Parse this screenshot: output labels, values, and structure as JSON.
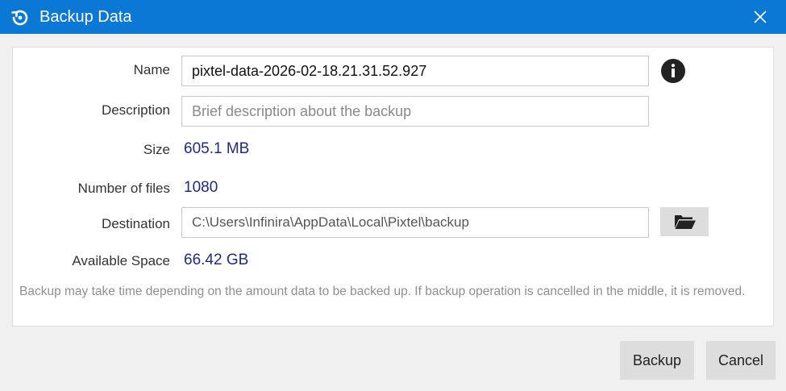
{
  "titlebar": {
    "title": "Backup Data",
    "icon": "restore-icon",
    "close_icon": "close-icon"
  },
  "form": {
    "name_label": "Name",
    "name_value": "pixtel-data-2026-02-18.21.31.52.927",
    "info_icon": "info-icon",
    "description_label": "Description",
    "description_value": "",
    "description_placeholder": "Brief description about the backup",
    "size_label": "Size",
    "size_value": "605.1 MB",
    "files_label": "Number of files",
    "files_value": "1080",
    "destination_label": "Destination",
    "destination_value": "C:\\Users\\Infinira\\AppData\\Local\\Pixtel\\backup",
    "folder_icon": "folder-open-icon",
    "space_label": "Available Space",
    "space_value": "66.42 GB",
    "note": "Backup may take time depending on the amount data to be backed up. If backup operation is cancelled in the middle, it is removed."
  },
  "footer": {
    "backup_label": "Backup",
    "cancel_label": "Cancel"
  },
  "colors": {
    "titlebar": "#0a78d4",
    "value_text": "#1f2b7c",
    "note_text": "#8f8f8f",
    "button_bg": "#dddddd"
  }
}
